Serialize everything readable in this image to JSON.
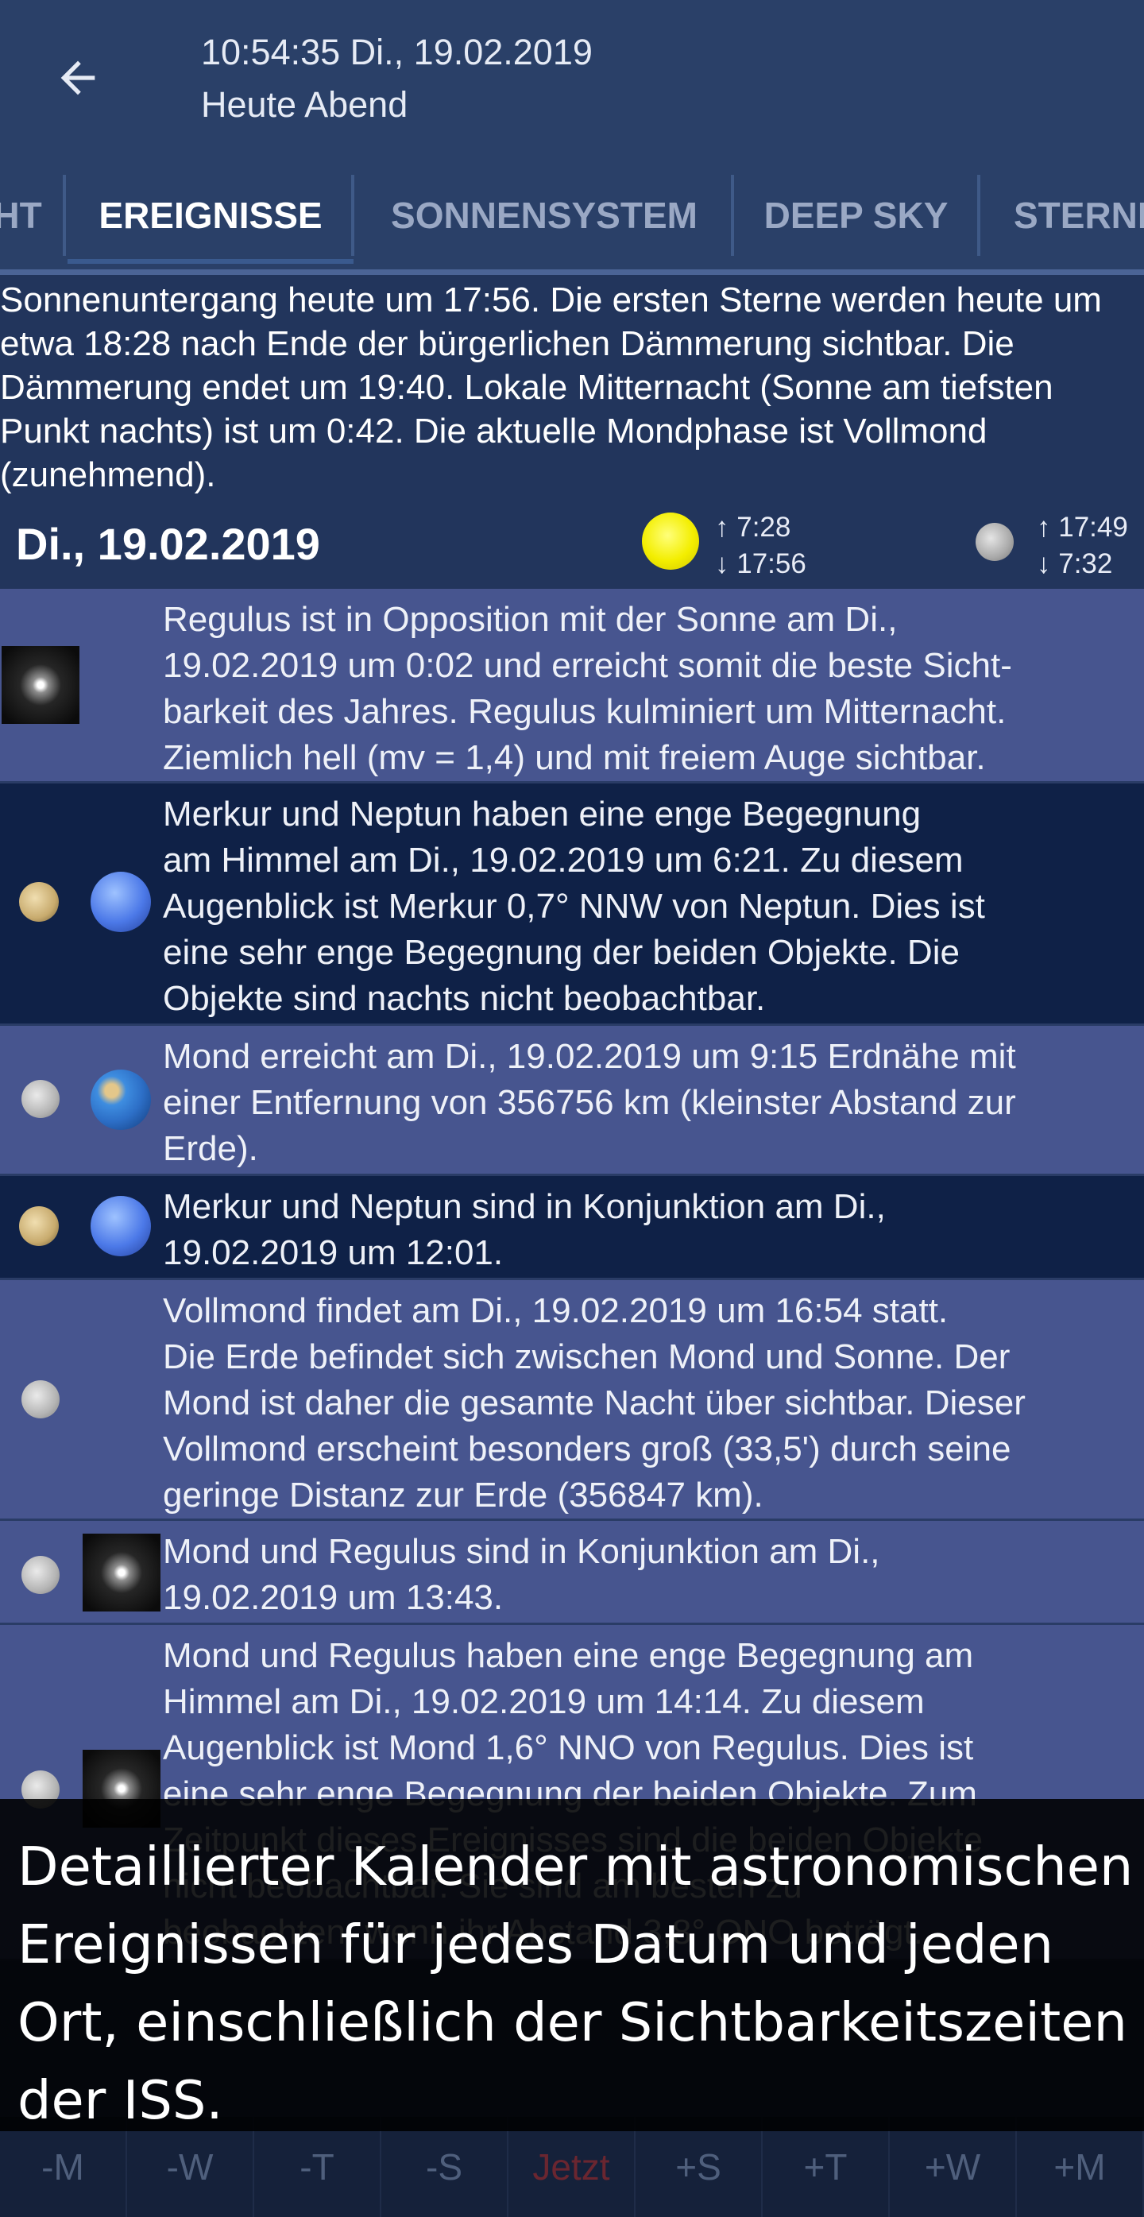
{
  "toolbar": {
    "time": "10:54:35 Di., 19.02.2019",
    "subtitle": "Heute Abend"
  },
  "tabs": [
    {
      "label": "HT"
    },
    {
      "label": "EREIGNISSE"
    },
    {
      "label": "SONNENSYSTEM"
    },
    {
      "label": "DEEP SKY"
    },
    {
      "label": "STERNE"
    }
  ],
  "summary": "Sonnenuntergang heute um 17:56. Die ersten Sterne werden heute um etwa 18:28 nach Ende der bürgerlichen Dämmerung sichtbar. Die Dämmerung endet um 19:40. Lokale Mitternacht (Sonne am tiefsten Punkt nachts) ist um 0:42. Die aktuelle Mondphase ist Vollmond (zunehmend).",
  "date_header": {
    "date": "Di., 19.02.2019",
    "sun_rise": "↑ 7:28",
    "sun_set": "↓ 17:56",
    "moon_rise": "↑ 17:49",
    "moon_set": "↓ 7:32"
  },
  "events": [
    {
      "text": "Regulus ist in Opposition mit der Sonne am Di.,\n19.02.2019 um 0:02 und erreicht somit die beste Sicht-\nbarkeit des Jahres. Regulus kulminiert um Mitternacht.\nZiemlich hell (mv = 1,4) und mit freiem Auge sichtbar.",
      "icons": [
        "star-icon"
      ]
    },
    {
      "text": "Merkur und Neptun haben eine enge Begegnung\nam Himmel am Di., 19.02.2019 um 6:21. Zu diesem\nAugenblick ist Merkur 0,7° NNW von Neptun. Dies ist\neine sehr enge Begegnung der beiden Objekte. Die\nObjekte sind nachts nicht beobachtbar.",
      "icons": [
        "mercury-icon",
        "neptune-icon"
      ]
    },
    {
      "text": "Mond erreicht am Di., 19.02.2019 um 9:15 Erdnähe mit\neiner Entfernung von 356756 km (kleinster Abstand zur\nErde).",
      "icons": [
        "moon-icon",
        "earth-icon"
      ]
    },
    {
      "text": "Merkur und Neptun sind in Konjunktion am Di.,\n19.02.2019 um 12:01.",
      "icons": [
        "mercury-icon",
        "neptune-icon"
      ]
    },
    {
      "text": "Vollmond findet am Di., 19.02.2019 um 16:54 statt.\nDie Erde befindet sich zwischen Mond und Sonne. Der\nMond ist daher die gesamte Nacht über sichtbar. Dieser\nVollmond erscheint besonders groß (33,5') durch seine\ngeringe Distanz zur Erde (356847 km).",
      "icons": [
        "moon-icon"
      ]
    },
    {
      "text": "Mond und Regulus sind in Konjunktion am Di.,\n19.02.2019 um 13:43.",
      "icons": [
        "moon-icon",
        "star-icon"
      ]
    },
    {
      "text": "Mond und Regulus haben eine enge Begegnung am\nHimmel am Di., 19.02.2019 um 14:14. Zu diesem\nAugenblick ist Mond 1,6° NNO von Regulus. Dies ist\neine sehr enge Begegnung der beiden Objekte. Zum\nZeitpunkt dieses Ereignisses sind die beiden Objekte\nnicht beobachtbar. Sie sind am besten zu\nbeobachten, wenn ihr Abstand 3,8° ONO beträgt.",
      "icons": [
        "moon-icon",
        "star-icon"
      ]
    }
  ],
  "bottom_nav": [
    "-M",
    "-W",
    "-T",
    "-S",
    "Jetzt",
    "+S",
    "+T",
    "+W",
    "+M"
  ],
  "caption": "Detaillierter Kalender mit astronomischen Ereignissen für jedes Datum und jeden Ort, einschließlich der Sichtbarkeitszeiten der ISS.",
  "colors": {
    "toolbar_bg": "#2a4068",
    "row_light": "#47558f",
    "row_dark": "#0f2147",
    "sun": "#f3ee00"
  }
}
